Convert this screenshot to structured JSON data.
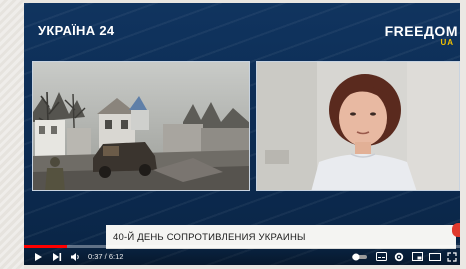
{
  "channel": {
    "logo_left": "УКРАЇНА 24",
    "logo_right": "FREEДOM",
    "logo_right_sub": "UA"
  },
  "lower_third": {
    "text": "40-Й ДЕНЬ СОПРОТИВЛЕНИЯ УКРАИНЫ"
  },
  "player": {
    "current_time": "0:37",
    "duration": "6:12",
    "time_display": "0:37 / 6:12",
    "progress_fraction": 0.099,
    "progress_color": "#ff0000"
  },
  "icons": {
    "play": "play-icon",
    "next": "next-icon",
    "volume": "volume-icon",
    "autoplay": "autoplay-toggle-icon",
    "subtitles": "subtitles-icon",
    "settings": "gear-icon",
    "miniplayer": "miniplayer-icon",
    "theater": "theater-mode-icon",
    "fullscreen": "fullscreen-icon"
  },
  "colors": {
    "background": "#0e2d56",
    "logo_accent": "#f3c200",
    "lower_third_bg": "#f4f4f2"
  }
}
